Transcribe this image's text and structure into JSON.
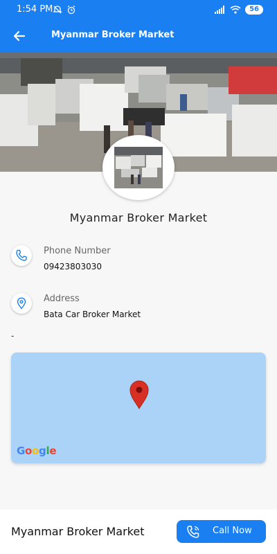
{
  "status_bar": {
    "time": "1:54 PM",
    "battery": "56"
  },
  "app_bar": {
    "title": "Myanmar Broker Market"
  },
  "profile": {
    "name": "Myanmar Broker Market"
  },
  "contact": {
    "phone_label": "Phone Number",
    "phone_value": "09423803030",
    "address_label": "Address",
    "address_value": "Bata Car Broker Market",
    "extra": "-"
  },
  "map": {
    "logo": "Google"
  },
  "bottom_bar": {
    "name": "Myanmar Broker Market",
    "call_label": "Call Now"
  },
  "colors": {
    "accent": "#1a7ff0",
    "map_water": "#abd3f8",
    "pin": "#d93025"
  }
}
